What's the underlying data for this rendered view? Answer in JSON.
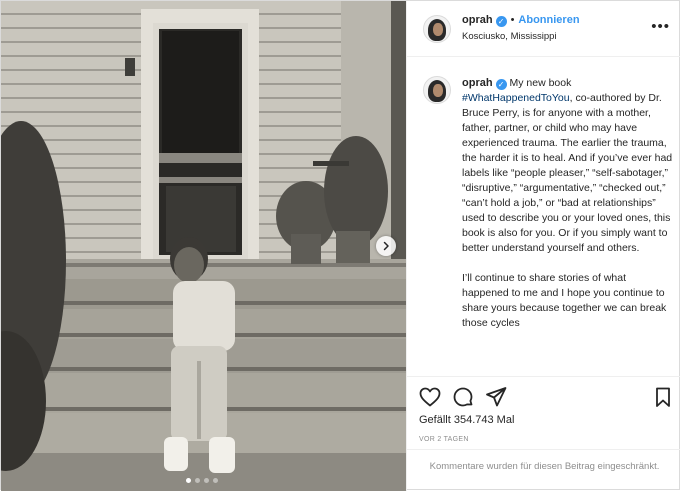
{
  "post": {
    "username": "oprah",
    "verified_mark": "✓",
    "separator": "•",
    "follow_label": "Abonnieren",
    "location": "Kosciusko, Mississippi",
    "more_icon": "more-horizontal-icon",
    "more_label": "•••",
    "caption": {
      "username": "oprah",
      "text_1": "My new book",
      "hashtag": "#WhatHappenedToYou",
      "text_2": ", co-authored by Dr. Bruce Perry, is for anyone with a mother, father, partner, or child who may have experienced trauma. The earlier the trauma, the harder it is to heal. And if you’ve ever had labels like “people pleaser,” “self-sabotager,” “disruptive,” “argumentative,” “checked out,” “can’t hold a job,” or “bad at relationships” used to describe you or your loved ones, this book is also for you. Or if you simply want to better understand yourself and others.",
      "paragraph_2": "I’ll continue to share stories of what happened to me and I hope you continue to share yours because together we can break those cycles"
    },
    "likes": "Gefällt 354.743 Mal",
    "date": "VOR 2 TAGEN",
    "comments_disabled": "Kommentare wurden für diesen Beitrag eingeschränkt.",
    "carousel": {
      "slides": 4,
      "active_index": 0
    }
  },
  "icons": {
    "like": "heart-icon",
    "comment": "comment-icon",
    "share": "share-icon",
    "save": "bookmark-icon",
    "next": "chevron-right-icon"
  },
  "colors": {
    "accent": "#3897f0",
    "hashtag": "#00376b",
    "text": "#262626",
    "muted": "#8e8e8e",
    "border": "#efefef"
  }
}
